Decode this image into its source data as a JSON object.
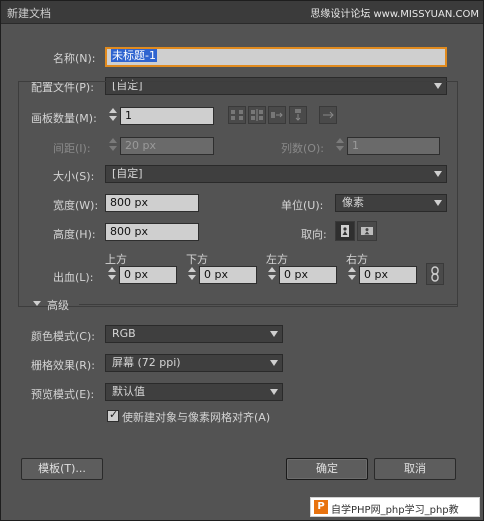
{
  "window": {
    "title": "新建文档",
    "watermark": "思缘设计论坛 www.MISSYUAN.COM"
  },
  "name": {
    "label": "名称(N):",
    "value": "未标题-1"
  },
  "profile": {
    "label": "配置文件(P):",
    "value": "[自定]"
  },
  "artboards": {
    "label": "画板数量(M):",
    "value": "1"
  },
  "spacing": {
    "label": "间距(I):",
    "value": "20 px"
  },
  "columns": {
    "label": "列数(O):",
    "value": "1"
  },
  "size": {
    "label": "大小(S):",
    "value": "[自定]"
  },
  "width": {
    "label": "宽度(W):",
    "value": "800 px"
  },
  "units": {
    "label": "单位(U):",
    "value": "像素"
  },
  "height": {
    "label": "高度(H):",
    "value": "800 px"
  },
  "orientation": {
    "label": "取向:"
  },
  "bleed": {
    "label": "出血(L):",
    "top": {
      "label": "上方",
      "value": "0 px"
    },
    "bottom": {
      "label": "下方",
      "value": "0 px"
    },
    "left": {
      "label": "左方",
      "value": "0 px"
    },
    "right": {
      "label": "右方",
      "value": "0 px"
    }
  },
  "advanced": {
    "label": "高级"
  },
  "color_mode": {
    "label": "颜色模式(C):",
    "value": "RGB"
  },
  "raster": {
    "label": "栅格效果(R):",
    "value": "屏幕 (72 ppi)"
  },
  "preview": {
    "label": "预览模式(E):",
    "value": "默认值"
  },
  "align": {
    "label": "使新建对象与像素网格对齐(A)",
    "checked": true
  },
  "buttons": {
    "templates": "模板(T)...",
    "ok": "确定",
    "cancel": "取消"
  },
  "overlay": {
    "site": "自学PHP网_php学习_php教"
  },
  "colors": {
    "focus": "#e08a1e",
    "selection": "#2f64d0"
  },
  "icons": [
    "grid-by-row-icon",
    "grid-by-column-icon",
    "arrange-by-row-icon",
    "arrange-by-column-icon",
    "right-to-left-icon",
    "portrait-icon",
    "landscape-icon",
    "link-bleed-icon",
    "disclosure-triangle-icon",
    "php-logo-icon"
  ]
}
